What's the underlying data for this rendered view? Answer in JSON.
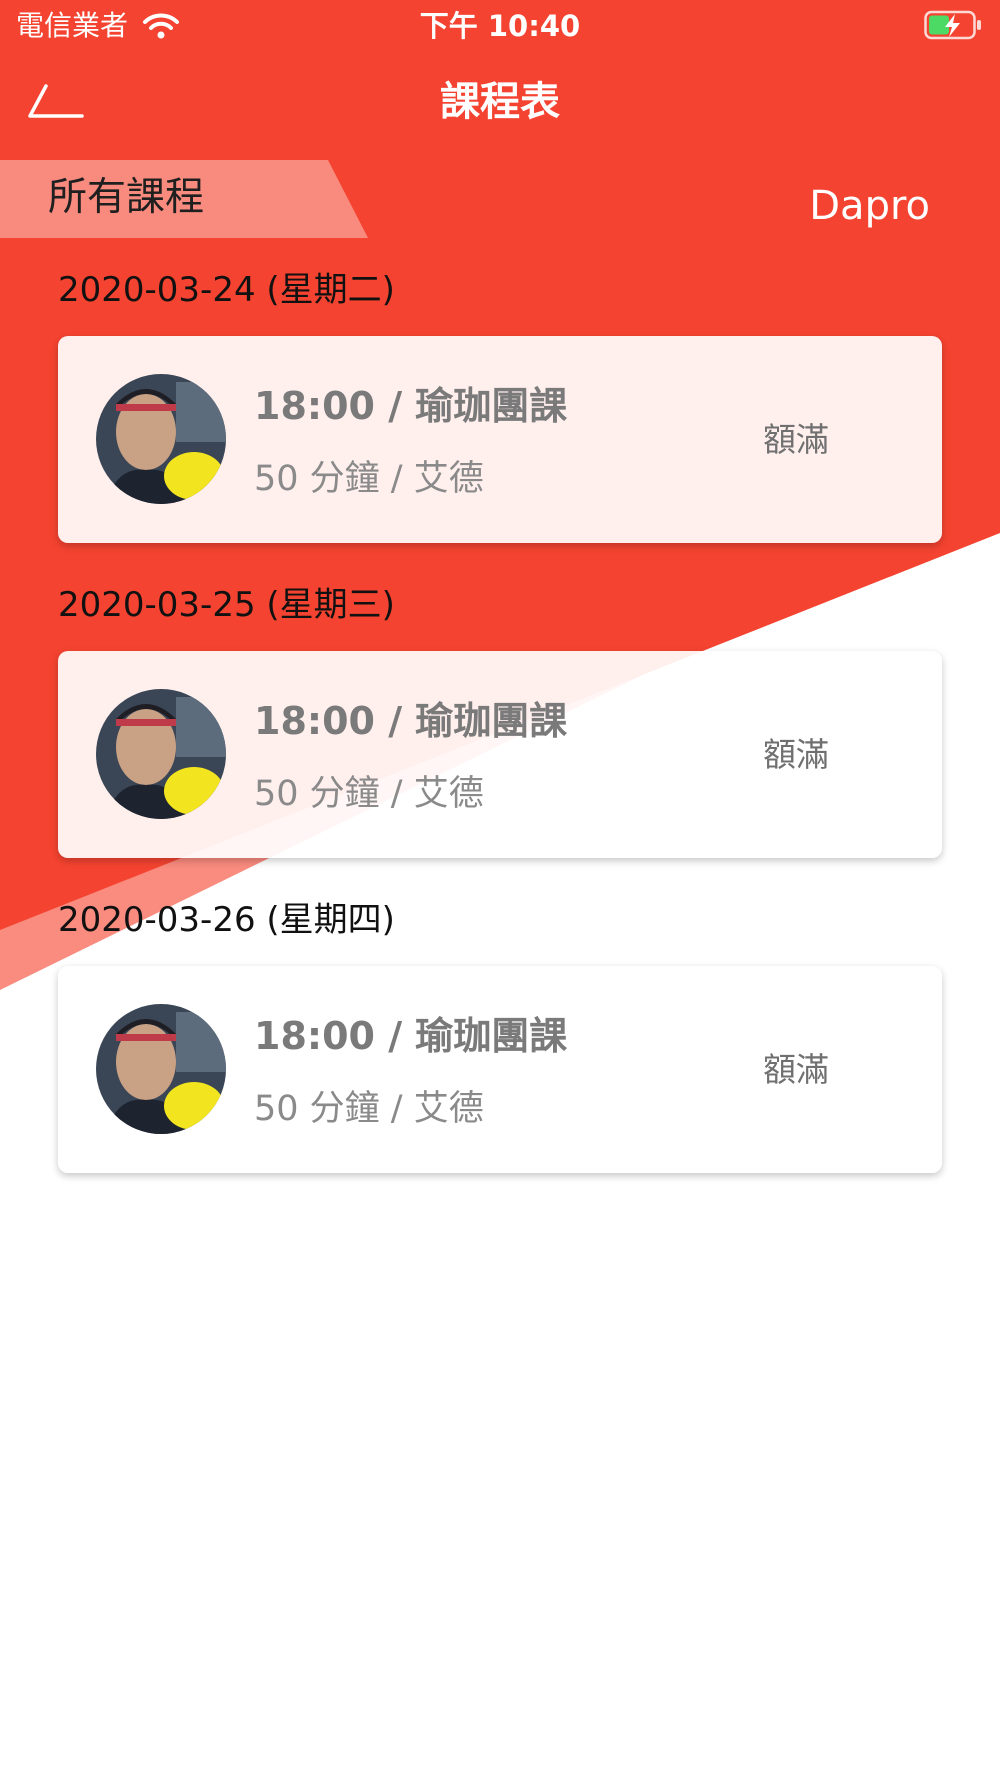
{
  "status_bar": {
    "carrier": "電信業者",
    "time": "下午 10:40",
    "icons": [
      "wifi-icon",
      "battery-charging-icon"
    ]
  },
  "nav": {
    "title": "課程表",
    "back_icon": "back-arrow-icon"
  },
  "tabs": {
    "all": "所有課程",
    "other": "Dapro"
  },
  "colors": {
    "primary": "#f44330",
    "tab_active": "#f88a7e",
    "text_muted": "#7a7a7a"
  },
  "schedule": [
    {
      "date": "2020-03-24 (星期二)",
      "class": {
        "time_title": "18:00 / 瑜珈團課",
        "meta": "50 分鐘 / 艾德",
        "status": "額滿"
      }
    },
    {
      "date": "2020-03-25 (星期三)",
      "class": {
        "time_title": "18:00 / 瑜珈團課",
        "meta": "50 分鐘 / 艾德",
        "status": "額滿"
      }
    },
    {
      "date": "2020-03-26 (星期四)",
      "class": {
        "time_title": "18:00 / 瑜珈團課",
        "meta": "50 分鐘 / 艾德",
        "status": "額滿"
      }
    }
  ]
}
